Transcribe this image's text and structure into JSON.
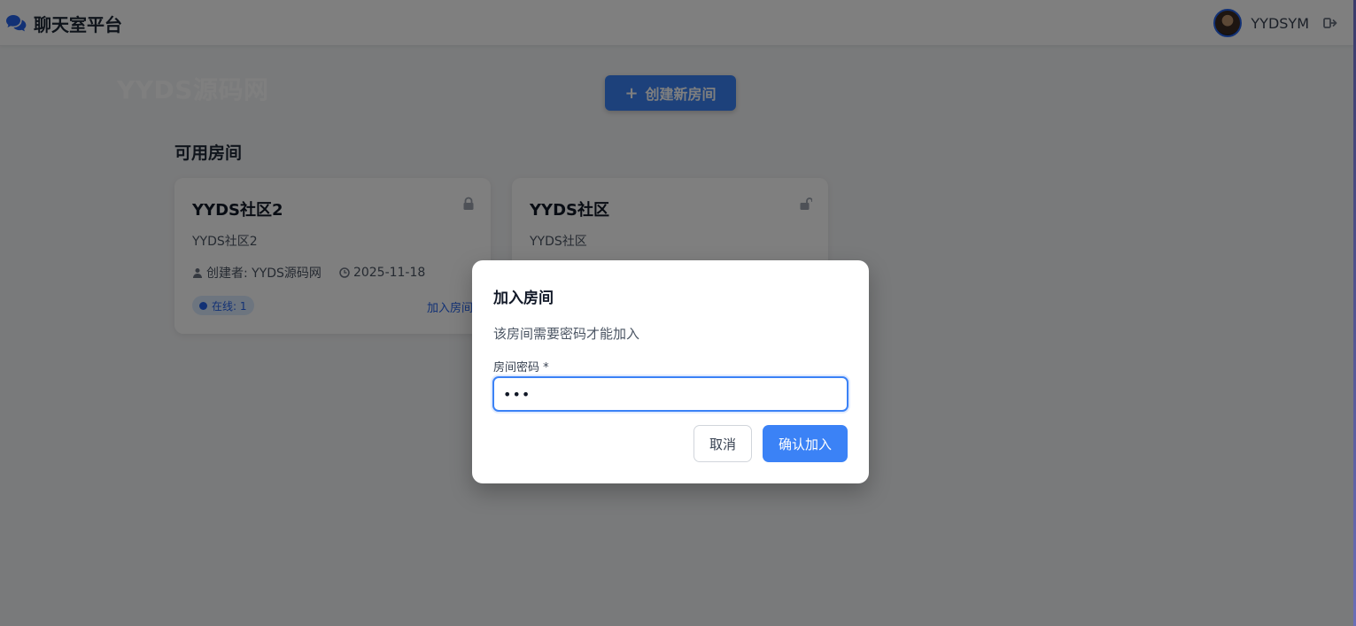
{
  "header": {
    "brand_title": "聊天室平台",
    "brand_icon": "comments-icon",
    "username": "YYDSYM",
    "logout_icon": "logout-icon"
  },
  "main": {
    "site_title": "YYDS源码网",
    "create_button_label": "创建新房间",
    "section_title": "可用房间",
    "rooms": [
      {
        "name": "YYDS社区2",
        "description": "YYDS社区2",
        "creator": "创建者: YYDS源码网",
        "date": "2025-11-18",
        "online": "在线: 1",
        "join_label": "加入房间",
        "locked": true
      },
      {
        "name": "YYDS社区",
        "description": "YYDS社区",
        "locked": false
      }
    ]
  },
  "modal": {
    "title": "加入房间",
    "description": "该房间需要密码才能加入",
    "field_label": "房间密码 *",
    "password_value": "123",
    "cancel_label": "取消",
    "confirm_label": "确认加入"
  },
  "colors": {
    "accent": "#3b82f6",
    "link": "#2563eb",
    "overlay": "rgba(0,0,0,0.5)"
  }
}
